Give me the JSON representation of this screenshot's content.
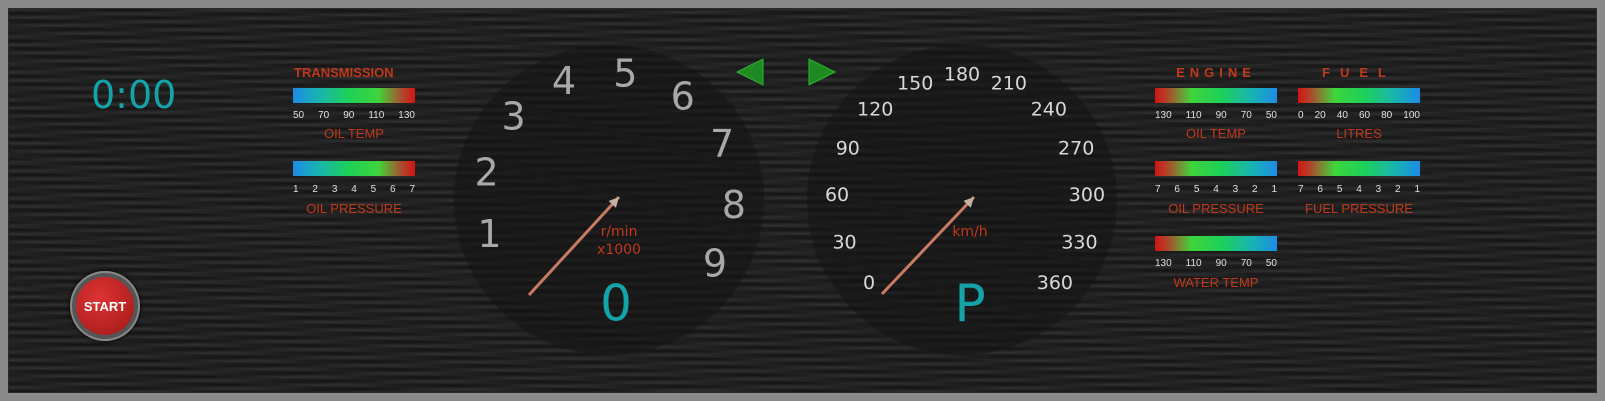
{
  "timer": "0:00",
  "start_button": {
    "label": "START"
  },
  "transmission": {
    "title": "TRANSMISSION",
    "oil_temp": {
      "ticks": [
        "50",
        "70",
        "90",
        "110",
        "130"
      ],
      "label": "OIL TEMP"
    },
    "oil_pressure": {
      "ticks": [
        "1",
        "2",
        "3",
        "4",
        "5",
        "6",
        "7"
      ],
      "label": "OIL PRESSURE"
    }
  },
  "engine": {
    "title": "ENGINE",
    "oil_temp": {
      "ticks": [
        "130",
        "110",
        "90",
        "70",
        "50"
      ],
      "label": "OIL TEMP"
    },
    "oil_pressure": {
      "ticks": [
        "7",
        "6",
        "5",
        "4",
        "3",
        "2",
        "1"
      ],
      "label": "OIL PRESSURE"
    },
    "water_temp": {
      "ticks": [
        "130",
        "110",
        "90",
        "70",
        "50"
      ],
      "label": "WATER TEMP"
    }
  },
  "fuel": {
    "title": "FUEL",
    "litres": {
      "ticks": [
        "0",
        "20",
        "40",
        "60",
        "80",
        "100"
      ],
      "label": "LITRES"
    },
    "fuel_pressure": {
      "ticks": [
        "7",
        "6",
        "5",
        "4",
        "3",
        "2",
        "1"
      ],
      "label": "FUEL PRESSURE"
    }
  },
  "tachometer": {
    "numbers": [
      "1",
      "2",
      "3",
      "4",
      "5",
      "6",
      "7",
      "8",
      "9"
    ],
    "unit_line1": "r/min",
    "unit_line2": "x1000",
    "readout": "0"
  },
  "speedometer": {
    "numbers": [
      "0",
      "30",
      "60",
      "90",
      "120",
      "150",
      "180",
      "210",
      "240",
      "270",
      "300",
      "330",
      "360"
    ],
    "unit": "km/h",
    "gear": "P"
  },
  "colors": {
    "accent": "#14a3a8",
    "label_red": "#c0391b",
    "arrow_green": "#1f8a22",
    "needle": "#c87a62"
  },
  "icons": {
    "left": "left-turn-arrow-icon",
    "right": "right-turn-arrow-icon"
  }
}
